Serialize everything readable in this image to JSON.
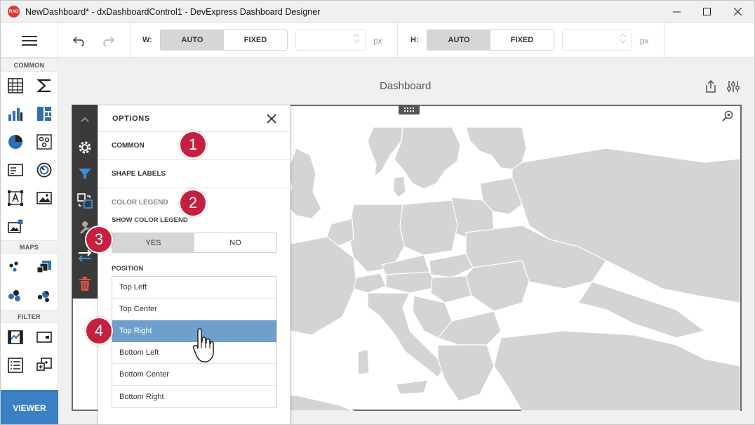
{
  "window": {
    "title": "NewDashboard* - dxDashboardControl1 - DevExpress Dashboard Designer",
    "logo_text": "RAD"
  },
  "toolbar": {
    "width_label": "W:",
    "height_label": "H:",
    "auto_label": "AUTO",
    "fixed_label": "FIXED",
    "width_value": "",
    "height_value": "",
    "unit": "px",
    "width_mode": "AUTO",
    "height_mode": "AUTO"
  },
  "toolbox": {
    "groups": [
      {
        "label": "COMMON",
        "items": [
          "grid-icon",
          "sum-icon",
          "bar-chart-icon",
          "treemap-icon",
          "pie-icon",
          "scatter-icon",
          "card-icon",
          "gauge-icon",
          "text-box-icon",
          "image-icon",
          "bound-image-icon"
        ]
      },
      {
        "label": "MAPS",
        "items": [
          "geo-point-map-icon",
          "bubble-map-icon",
          "pie-map-icon",
          "choropleth-map-icon"
        ]
      },
      {
        "label": "FILTER",
        "items": [
          "range-filter-icon",
          "combo-box-icon",
          "list-box-icon",
          "tree-view-icon"
        ]
      }
    ],
    "viewer_label": "VIEWER"
  },
  "dashboard": {
    "title": "Dashboard"
  },
  "options": {
    "title": "OPTIONS",
    "sections": {
      "common": "COMMON",
      "shape_labels": "SHAPE LABELS",
      "color_legend": "COLOR LEGEND"
    },
    "show_color_legend_label": "SHOW COLOR LEGEND",
    "yes_label": "YES",
    "no_label": "NO",
    "show_color_legend": "YES",
    "position_label": "POSITION",
    "positions": [
      "Top Left",
      "Top Center",
      "Top Right",
      "Bottom Left",
      "Bottom Center",
      "Bottom Right"
    ],
    "selected_position": "Top Right"
  },
  "callouts": [
    "1",
    "2",
    "3",
    "4"
  ],
  "colors": {
    "accent": "#3b7fc4",
    "selected_row": "#6ea0ce",
    "callout": "#c5203f",
    "map_land": "#d4d4d4",
    "side_strip": "#3a3a3a",
    "delete_icon": "#d9534f",
    "filter_icon": "#3b8fd8"
  }
}
